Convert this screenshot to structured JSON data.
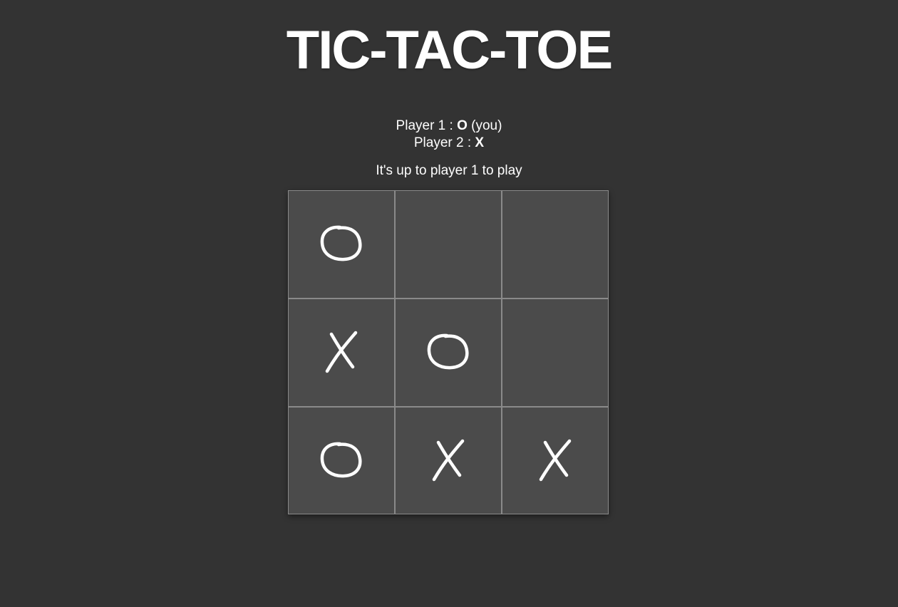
{
  "title": "TIC-TAC-TOE",
  "players": {
    "p1_prefix": "Player 1 : ",
    "p1_mark": "O",
    "p1_suffix": " (you)",
    "p2_prefix": "Player 2 : ",
    "p2_mark": "X"
  },
  "status": "It's up to player 1 to play",
  "board": [
    [
      "O",
      "",
      ""
    ],
    [
      "X",
      "O",
      ""
    ],
    [
      "O",
      "X",
      "X"
    ]
  ],
  "colors": {
    "background": "#333333",
    "cell": "#4b4b4b",
    "cell_border": "#8a8a8a",
    "mark": "#ffffff"
  },
  "icons": {
    "O": "hand-drawn-o-icon",
    "X": "hand-drawn-x-icon"
  }
}
